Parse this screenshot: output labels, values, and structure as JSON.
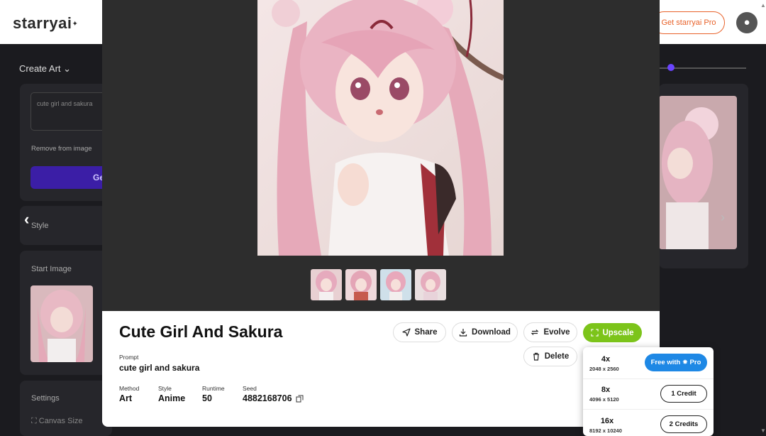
{
  "app": {
    "logo": "starryai",
    "logo_spark": "✦",
    "get_pro": "Get starryai Pro",
    "avatar_icon": "user-icon"
  },
  "sidebar": {
    "create_art": "Create Art ⌄",
    "prompt_value": "cute girl and sakura",
    "remove_label": "Remove from image",
    "generate_label": "Ge",
    "style_label": "Style",
    "start_image_label": "Start Image",
    "settings_label": "Settings",
    "canvas_size_label": "⛶ Canvas Size"
  },
  "modal": {
    "title": "Cute Girl And Sakura",
    "actions": {
      "share": "Share",
      "download": "Download",
      "evolve": "Evolve",
      "upscale": "Upscale",
      "delete": "Delete"
    },
    "prompt_label": "Prompt",
    "prompt_value": "cute girl and sakura",
    "meta": {
      "method_label": "Method",
      "method_value": "Art",
      "style_label": "Style",
      "style_value": "Anime",
      "runtime_label": "Runtime",
      "runtime_value": "50",
      "seed_label": "Seed",
      "seed_value": "4882168706"
    }
  },
  "upscale_menu": {
    "options": [
      {
        "mult": "4x",
        "res": "2048 x 2560",
        "button": "Free with ✸ Pro"
      },
      {
        "mult": "8x",
        "res": "4096 x 5120",
        "button": "1 Credit"
      },
      {
        "mult": "16x",
        "res": "8192 x 10240",
        "button": "2 Credits"
      }
    ]
  },
  "colors": {
    "upscale_green": "#7cc41a",
    "pro_blue": "#1e88e5",
    "brand_orange": "#e8622a",
    "generate_purple": "#3b1ea6"
  }
}
